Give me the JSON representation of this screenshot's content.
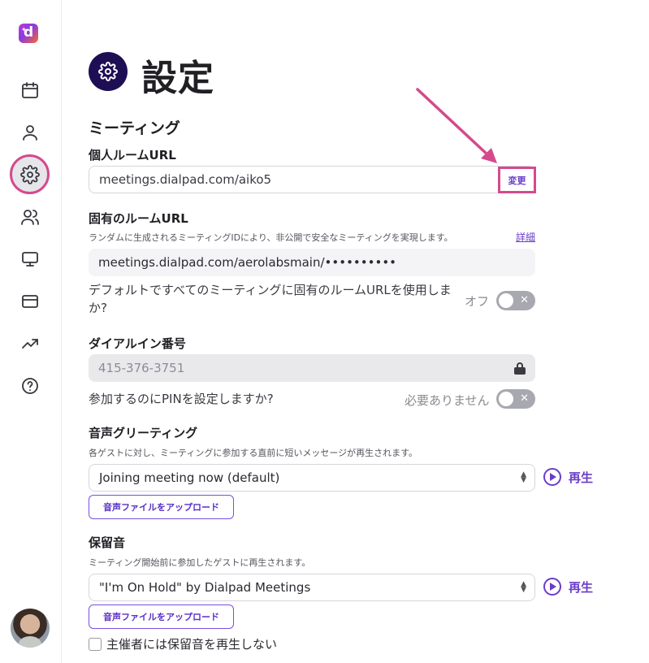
{
  "sidebar": {
    "logo_letter": "d",
    "items": [
      {
        "name": "calendar-icon"
      },
      {
        "name": "person-icon"
      },
      {
        "name": "settings-gear-icon",
        "active": true
      },
      {
        "name": "users-icon"
      },
      {
        "name": "monitor-icon"
      },
      {
        "name": "credit-card-icon"
      },
      {
        "name": "trending-up-icon"
      },
      {
        "name": "help-icon"
      }
    ],
    "accent_color": "#d44a8d"
  },
  "page": {
    "title": "設定"
  },
  "meeting": {
    "section_title": "ミーティング",
    "personal_room": {
      "label": "個人ルームURL",
      "value": "meetings.dialpad.com/aiko5",
      "change_label": "変更"
    },
    "unique_room": {
      "label": "固有のルームURL",
      "help": "ランダムに生成されるミーティングIDにより、非公開で安全なミーティングを実現します。",
      "details_link": "詳細",
      "value": "meetings.dialpad.com/aerolabsmain/••••••••••",
      "default_question_line1": "デフォルトですべてのミーティングに固有のルームURLを使用しま",
      "default_question_line2": "か?",
      "toggle_state": "オフ"
    },
    "dial_in": {
      "label": "ダイアルイン番号",
      "value": "415-376-3751",
      "pin_question": "参加するのにPINを設定しますか?",
      "pin_state": "必要ありません"
    },
    "greeting": {
      "label": "音声グリーティング",
      "help": "各ゲストに対し、ミーティングに参加する直前に短いメッセージが再生されます。",
      "selected": "Joining meeting now (default)",
      "play_label": "再生",
      "upload_label": "音声ファイルをアップロード"
    },
    "hold": {
      "label": "保留音",
      "help": "ミーティング開始前に参加したゲストに再生されます。",
      "selected": "\"I'm On Hold\" by Dialpad Meetings",
      "play_label": "再生",
      "upload_label": "音声ファイルをアップロード",
      "host_checkbox_label": "主催者には保留音を再生しない",
      "host_checkbox_checked": false
    }
  },
  "colors": {
    "brand_purple": "#6b3cc9",
    "badge_navy": "#1e0f54",
    "annotation_pink": "#d44a8d"
  }
}
